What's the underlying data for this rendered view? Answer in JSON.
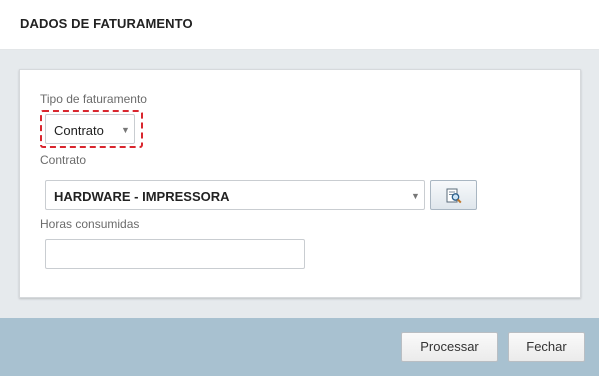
{
  "header": {
    "title": "DADOS DE FATURAMENTO"
  },
  "form": {
    "billing_type": {
      "label": "Tipo de faturamento",
      "value": "Contrato"
    },
    "contract": {
      "label": "Contrato",
      "value": "HARDWARE - IMPRESSORA"
    },
    "hours": {
      "label": "Horas consumidas",
      "value": ""
    }
  },
  "footer": {
    "process_label": "Processar",
    "close_label": "Fechar"
  },
  "colors": {
    "accent_outline": "#d9262e",
    "footer_bg": "#a8c1d0",
    "body_bg": "#e6eaed"
  }
}
